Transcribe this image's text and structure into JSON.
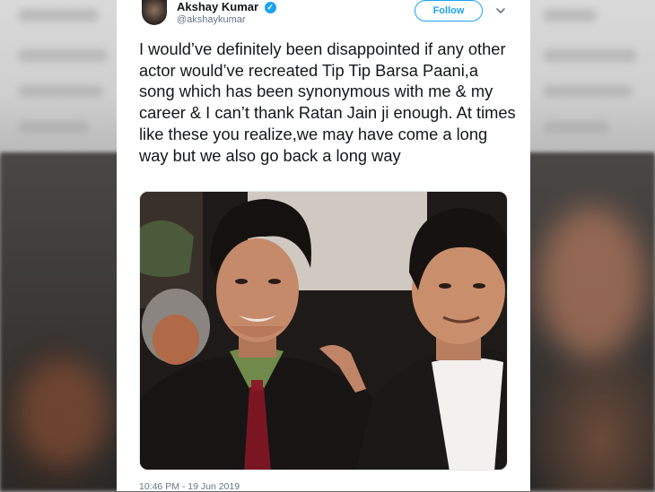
{
  "tweet": {
    "author_name": "Akshay Kumar",
    "author_handle": "@akshaykumar",
    "verified_icon": "✓",
    "follow_label": "Follow",
    "text": "I would’ve definitely been disappointed if any other actor would’ve recreated Tip Tip Barsa Paani,a song which has been synonymous with me & my career & I can’t thank Ratan Jain ji enough. At times like these you realize,we may have come a long way but we also go back a long way",
    "timestamp": "10:46 PM - 19 Jun 2019",
    "accent_color": "#1da1f2"
  },
  "icons": {
    "verified": "verified-badge-icon",
    "more": "chevron-down-icon"
  }
}
